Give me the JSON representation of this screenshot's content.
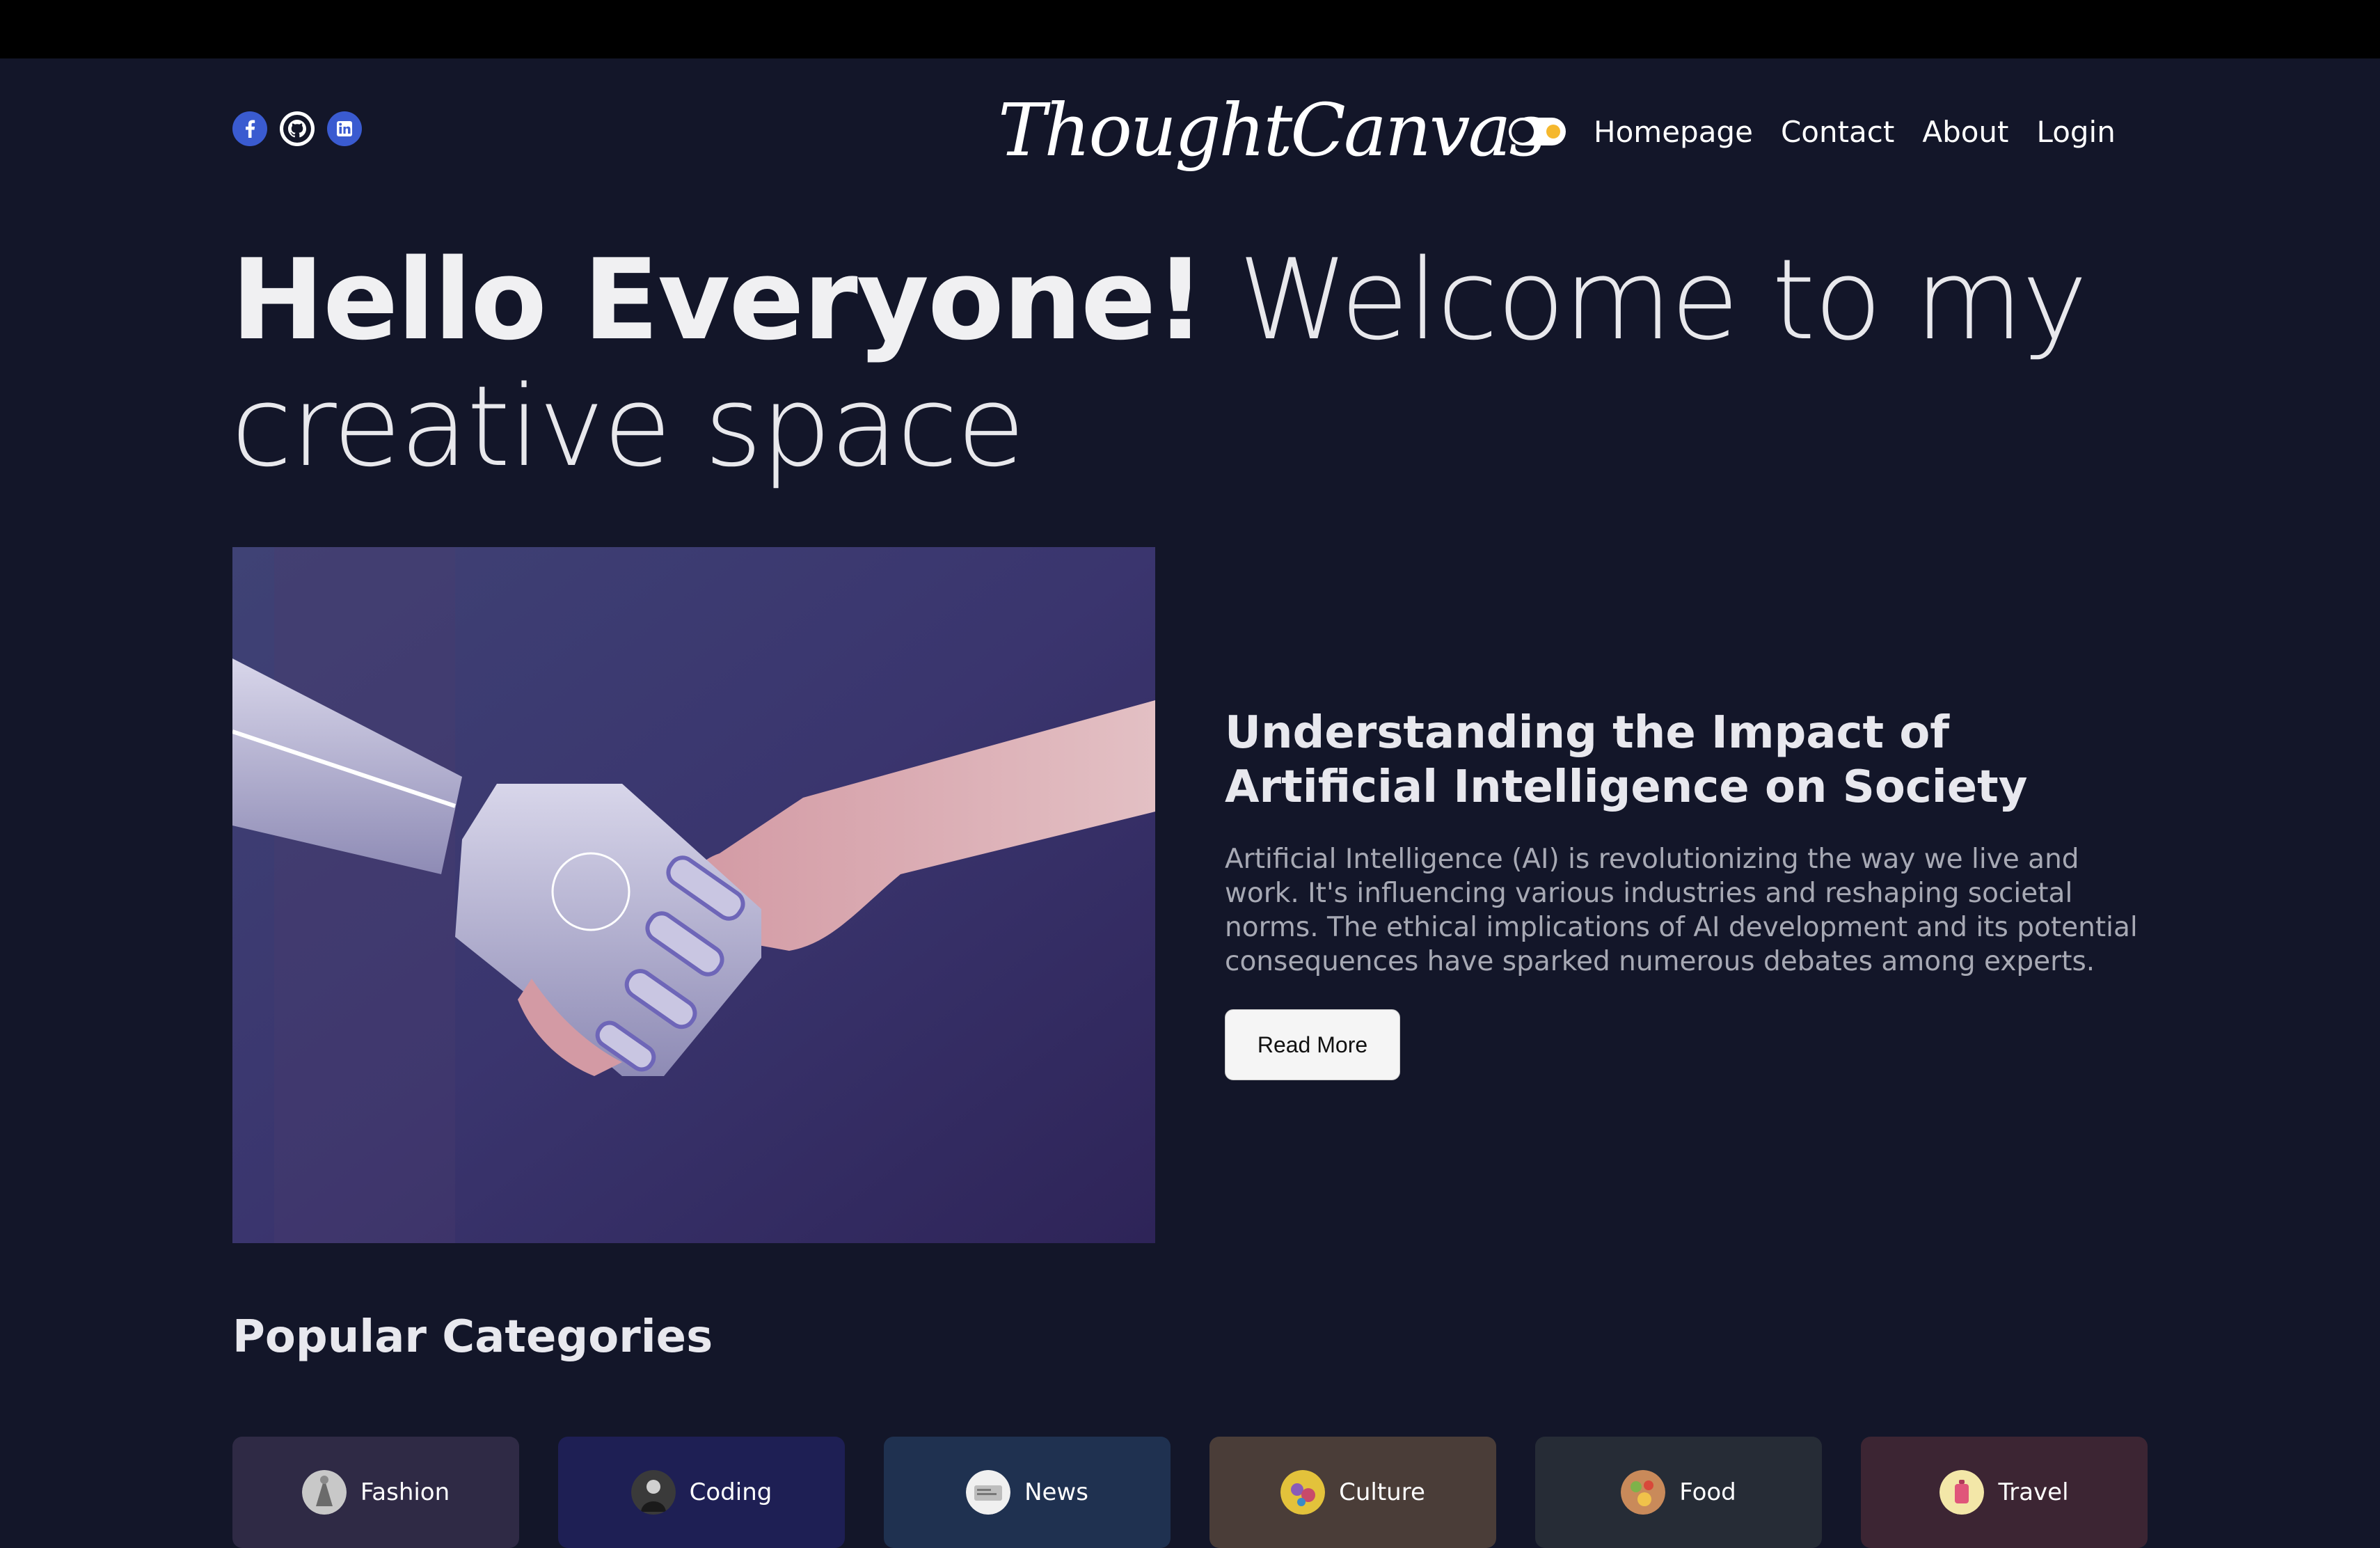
{
  "header": {
    "logo": "ThoughtCanvas",
    "social": [
      "facebook-icon",
      "github-icon",
      "linkedin-icon"
    ],
    "nav": {
      "homepage": "Homepage",
      "contact": "Contact",
      "about": "About",
      "login": "Login"
    }
  },
  "hero": {
    "bold": "Hello Everyone!",
    "light": " Welcome to my creative space"
  },
  "featured": {
    "title": "Understanding the Impact of Artificial Intelligence on Society",
    "description": "Artificial Intelligence (AI) is revolutionizing the way we live and work. It's influencing various industries and reshaping societal norms. The ethical implications of AI development and its potential consequences have sparked numerous debates among experts.",
    "button": "Read More"
  },
  "categories": {
    "title": "Popular Categories",
    "items": [
      {
        "label": "Fashion",
        "color": "#2f2a45"
      },
      {
        "label": "Coding",
        "color": "#1e1f54"
      },
      {
        "label": "News",
        "color": "#1f3150"
      },
      {
        "label": "Culture",
        "color": "#4a3d38"
      },
      {
        "label": "Food",
        "color": "#262c36"
      },
      {
        "label": "Travel",
        "color": "#3c2533"
      }
    ]
  },
  "colors": {
    "background": "#131629",
    "accent": "#f5b82e",
    "social_blue": "#3a5bd0"
  }
}
